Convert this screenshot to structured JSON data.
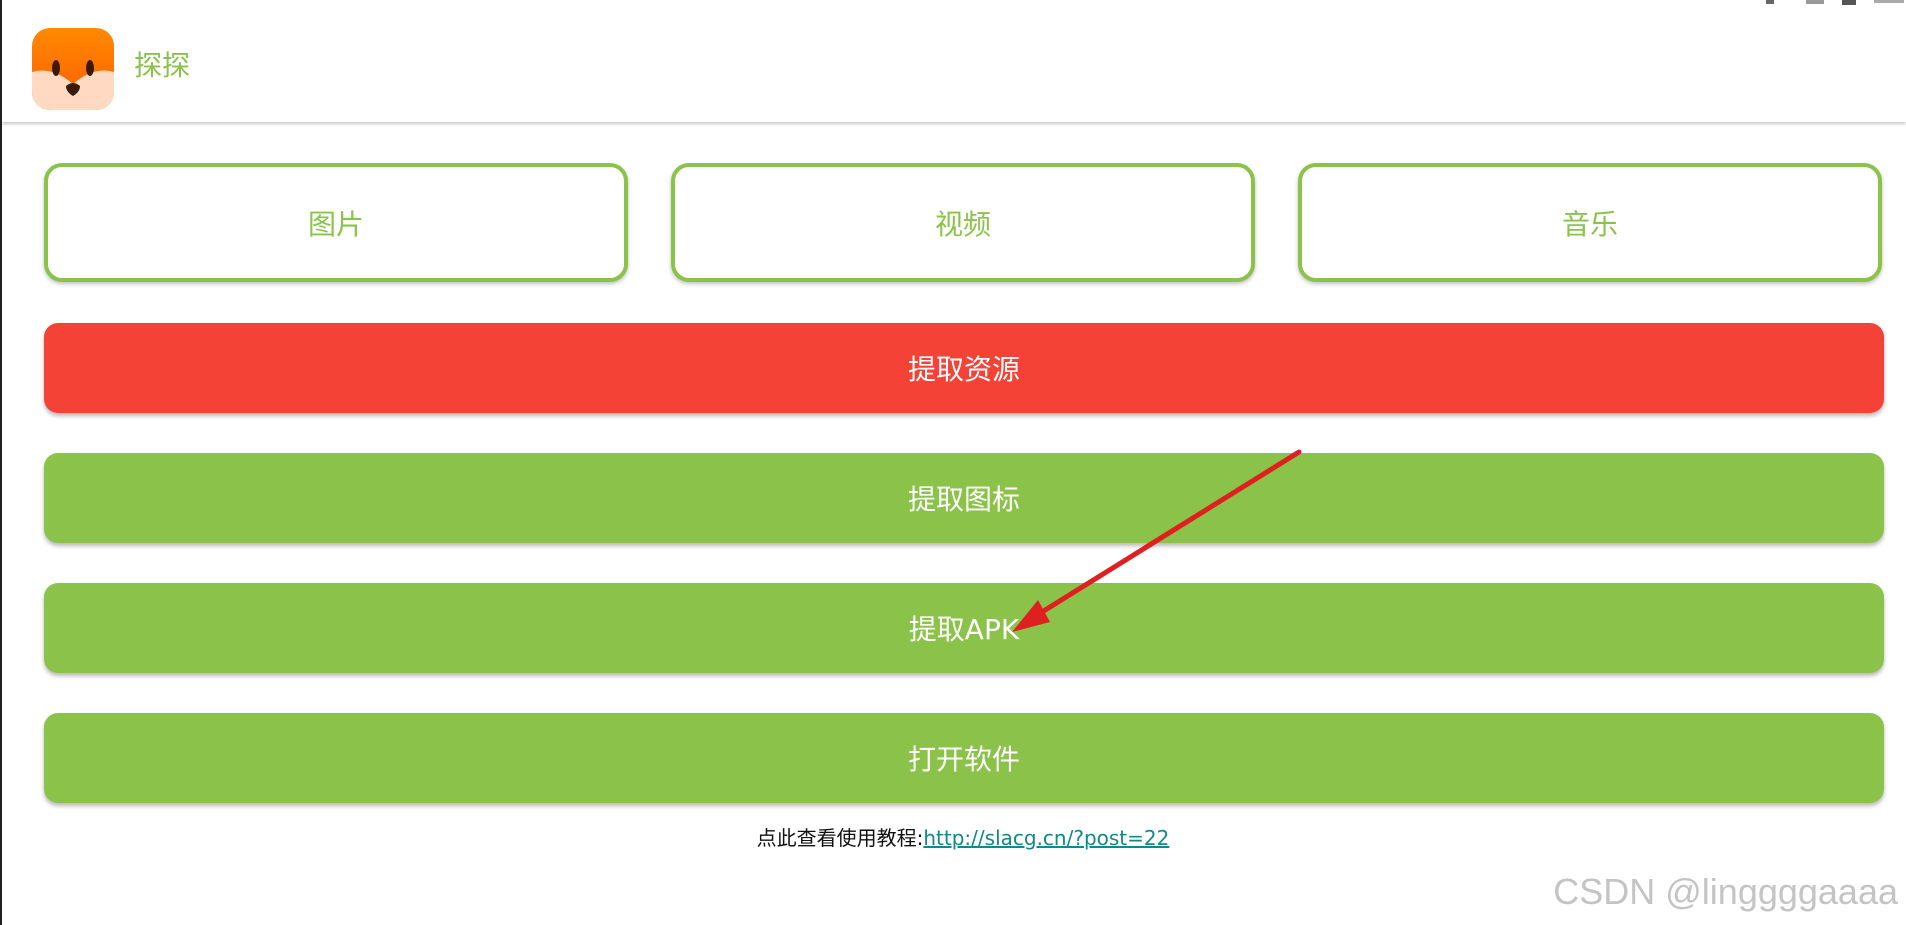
{
  "app": {
    "title": "探探",
    "icon": "fox-app-icon"
  },
  "tabs": [
    {
      "label": "图片"
    },
    {
      "label": "视频"
    },
    {
      "label": "音乐"
    }
  ],
  "actions": {
    "extract_resources": "提取资源",
    "extract_icon": "提取图标",
    "extract_apk": "提取APK",
    "open_app": "打开软件"
  },
  "tutorial": {
    "prefix": "点此查看使用教程:",
    "link": "http://slacg.cn/?post=22"
  },
  "watermark": "CSDN @linggggaaaa",
  "colors": {
    "accent_green": "#8bc34a",
    "danger_red": "#f44336",
    "annotation_arrow": "#e02020",
    "link": "#0f8a8a"
  }
}
